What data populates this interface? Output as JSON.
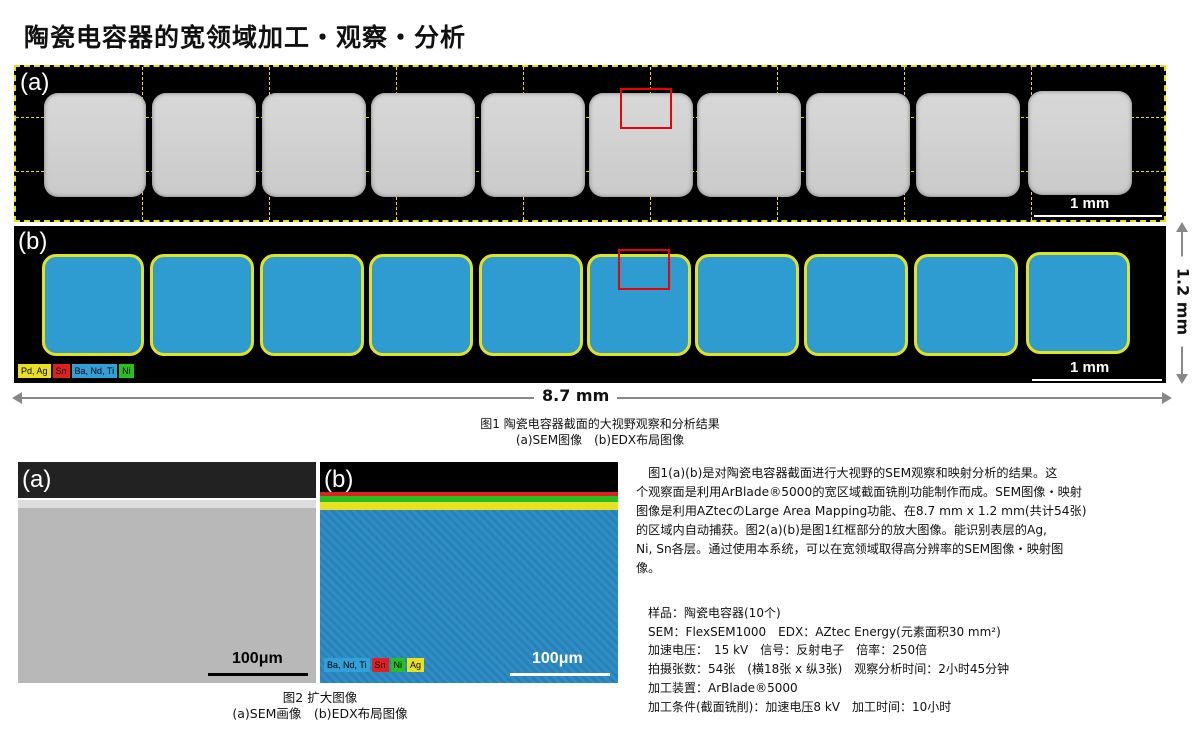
{
  "title": "陶瓷电容器的宽领域加工・观察・分析",
  "fig1": {
    "panel_a_label": "(a)",
    "panel_b_label": "(b)",
    "scale_a": "1 mm",
    "scale_b": "1 mm",
    "legend": [
      {
        "label": "Pd, Ag",
        "color": "#e8e020"
      },
      {
        "label": "Sn",
        "color": "#e02020"
      },
      {
        "label": "Ba, Nd, Ti",
        "color": "#2fa0d8"
      },
      {
        "label": "Ni",
        "color": "#28c020"
      }
    ],
    "height_dim": "1.2 mm",
    "width_dim": "8.7 mm",
    "caption_line1": "图1 陶瓷电容器截面的大视野观察和分析结果",
    "caption_line2": "(a)SEM图像　(b)EDX布局图像"
  },
  "fig2": {
    "panel_a_label": "(a)",
    "panel_b_label": "(b)",
    "scale_a": "100μm",
    "scale_b": "100μm",
    "legend": [
      {
        "label": "Ba, Nd, Ti",
        "color": "#2fa0d8"
      },
      {
        "label": "Sn",
        "color": "#e02020"
      },
      {
        "label": "Ni",
        "color": "#28c020"
      },
      {
        "label": "Ag",
        "color": "#e8e020"
      }
    ],
    "caption_line1": "图2 扩大图像",
    "caption_line2": "(a)SEM画像　(b)EDX布局图像"
  },
  "description": {
    "line1": "　图1(a)(b)是对陶瓷电容器截面进行大视野的SEM观察和映射分析的结果。这",
    "line2": "个观察面是利用ArBlade®5000的宽区域截面铣削功能制作而成。SEM图像・映射",
    "line3": "图像是利用AZtecのLarge Area Mapping功能、在8.7 mm x 1.2 mm(共计54张)",
    "line4": "的区域内自动捕获。图2(a)(b)是图1红框部分的放大图像。能识别表层的Ag,",
    "line5": "Ni, Sn各层。通过使用本系统，可以在宽领域取得高分辨率的SEM图像・映射图",
    "line6": "像。"
  },
  "info": {
    "sample": "样品：陶瓷电容器(10个)",
    "sem": "SEM：FlexSEM1000　EDX：AZtec Energy(元素面积30 mm²)",
    "voltage": "加速电压：　15 kV　信号：反射电子　倍率：250倍",
    "shots": "拍摄张数：54张　(横18张 x 纵3张)　观察分析时间：2小时45分钟",
    "device": "加工装置：ArBlade®5000",
    "conditions": "加工条件(截面铣削)：加速电压8 kV　加工时间：10小时"
  }
}
